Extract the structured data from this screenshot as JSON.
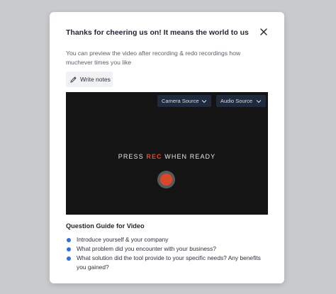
{
  "modal": {
    "title": "Thanks for cheering us on! It means the world to us",
    "description": "You can preview the video after recording & redo recordings how muchever times you like",
    "write_notes_label": "Write notes",
    "close_icon": "close-icon",
    "pencil_icon": "pencil-icon"
  },
  "video": {
    "camera_source_label": "Camera Source",
    "audio_source_label": "Audio Source",
    "press_prefix": "PRESS ",
    "press_rec": "REC",
    "press_suffix": " WHEN READY",
    "rec_color": "#d9482a",
    "background": "#141414"
  },
  "guide": {
    "title": "Question Guide for Video",
    "questions": [
      "Introduce yourself & your company",
      "What problem did you encounter with your business?",
      "What solution did the tool provide to your specific needs? Any benefits you gained?"
    ],
    "bullet_color": "#2f6fe0"
  }
}
